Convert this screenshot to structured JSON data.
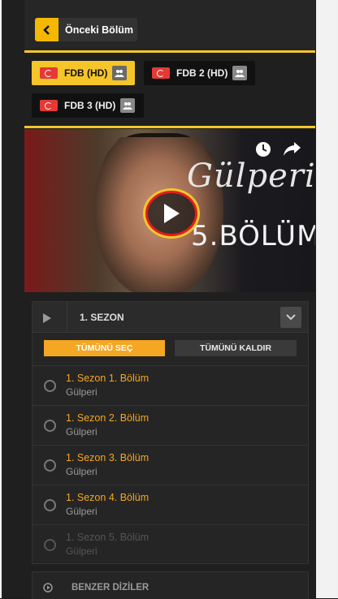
{
  "nav": {
    "prev_label": "Önceki Bölüm"
  },
  "sources": [
    {
      "label": "FDB (HD)",
      "active": true
    },
    {
      "label": "FDB 2 (HD)",
      "active": false
    },
    {
      "label": "FDB 3 (HD)",
      "active": false
    }
  ],
  "video": {
    "series_title": "Gülperi",
    "episode_title": "5.BÖLÜM"
  },
  "season": {
    "name": "1. SEZON",
    "select_all_label": "TÜMÜNÜ SEÇ",
    "remove_all_label": "TÜMÜNÜ KALDIR",
    "episodes": [
      {
        "title": "1. Sezon 1. Bölüm",
        "subtitle": "Gülperi"
      },
      {
        "title": "1. Sezon 2. Bölüm",
        "subtitle": "Gülperi"
      },
      {
        "title": "1. Sezon 3. Bölüm",
        "subtitle": "Gülperi"
      },
      {
        "title": "1. Sezon 4. Bölüm",
        "subtitle": "Gülperi"
      },
      {
        "title": "1. Sezon 5. Bölüm",
        "subtitle": "Gülperi"
      }
    ]
  },
  "similar": {
    "label": "BENZER DİZİLER"
  },
  "colors": {
    "accent": "#f5c52a",
    "orange": "#f5a623",
    "panel": "#1f1f1f"
  }
}
